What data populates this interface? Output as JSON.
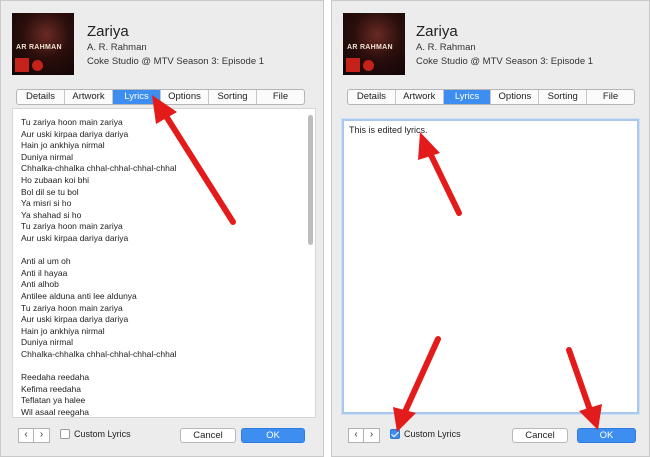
{
  "left_dialog": {
    "song": {
      "title": "Zariya",
      "artist": "A. R. Rahman",
      "album": "Coke Studio @ MTV Season 3: Episode 1"
    },
    "artwork_text": "AR RAHMAN",
    "tabs": [
      "Details",
      "Artwork",
      "Lyrics",
      "Options",
      "Sorting",
      "File"
    ],
    "active_tab": "Lyrics",
    "lyrics": [
      "Tu zariya hoon main zariya",
      "Aur uski kirpaa dariya dariya",
      "Hain jo ankhiya nirmal",
      "Duniya nirmal",
      "Chhalka-chhalka chhal-chhal-chhal-chhal",
      "Ho zubaan koi bhi",
      "Bol dil se tu bol",
      "Ya misri si ho",
      "Ya shahad si ho",
      "Tu zariya hoon main zariya",
      "Aur uski kirpaa dariya dariya",
      "",
      "Anti al um oh",
      "Anti il hayaa",
      "Anti alhob",
      "Antilee alduna anti lee aldunya",
      "Tu zariya hoon main zariya",
      "Aur uski kirpaa dariya dariya",
      "Hain jo ankhiya nirmal",
      "Duniya nirmal",
      "Chhalka-chhalka chhal-chhal-chhal-chhal",
      "",
      "Reedaha reedaha",
      "Kefima reedaha",
      "Teflatan ya halee",
      "Wil asaal reegaha"
    ],
    "nav_prev": "‹",
    "nav_next": "›",
    "custom_lyrics_label": "Custom Lyrics",
    "custom_lyrics_checked": false,
    "cancel_label": "Cancel",
    "ok_label": "OK"
  },
  "right_dialog": {
    "song": {
      "title": "Zariya",
      "artist": "A. R. Rahman",
      "album": "Coke Studio @ MTV Season 3: Episode 1"
    },
    "artwork_text": "AR RAHMAN",
    "tabs": [
      "Details",
      "Artwork",
      "Lyrics",
      "Options",
      "Sorting",
      "File"
    ],
    "active_tab": "Lyrics",
    "edited_lyrics": "This is edited lyrics.",
    "nav_prev": "‹",
    "nav_next": "›",
    "custom_lyrics_label": "Custom Lyrics",
    "custom_lyrics_checked": true,
    "cancel_label": "Cancel",
    "ok_label": "OK"
  },
  "colors": {
    "accent": "#3d8ef0",
    "annotation_arrow": "#e41b1b",
    "dialog_bg": "#ececec"
  }
}
